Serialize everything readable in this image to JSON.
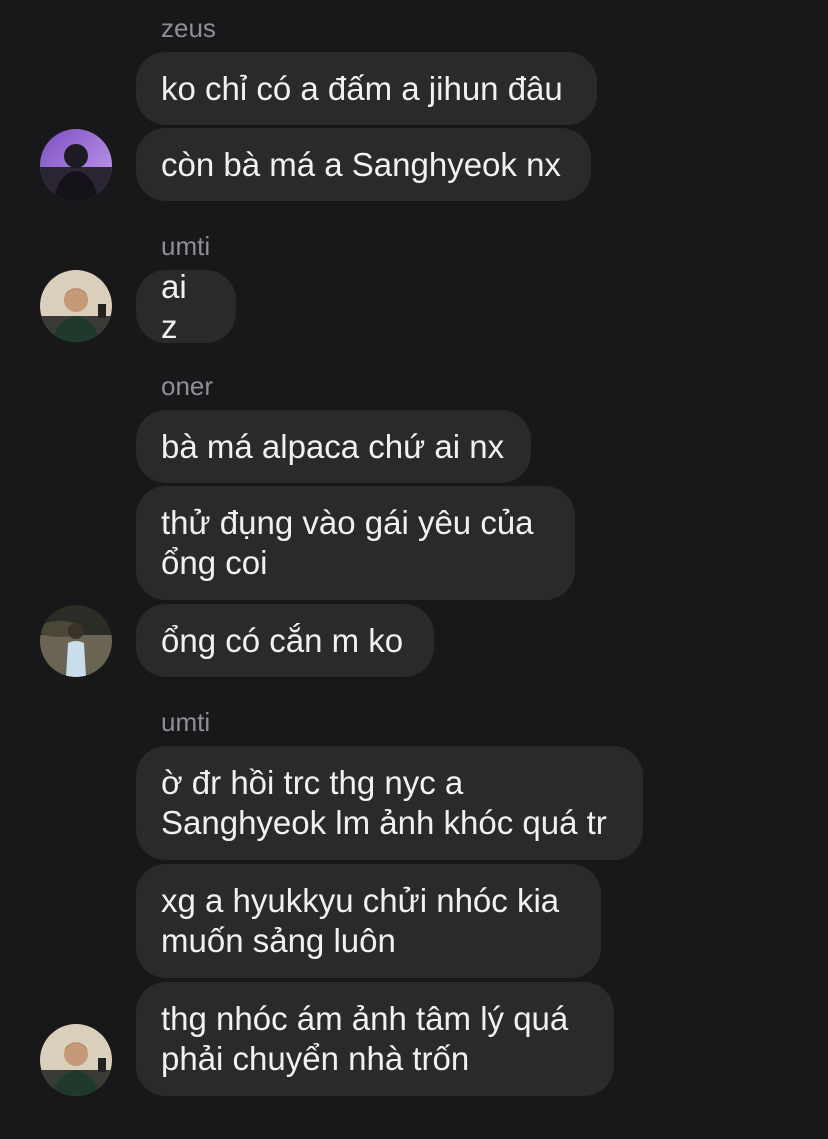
{
  "chat": {
    "groups": [
      {
        "sender": "zeus",
        "messages": [
          "ko chỉ có a đấm a jihun đâu",
          "còn bà má a Sanghyeok nx"
        ]
      },
      {
        "sender": "umti",
        "messages": [
          "ai z"
        ]
      },
      {
        "sender": "oner",
        "messages": [
          "bà má alpaca chứ ai nx",
          "thử đụng vào gái yêu của\nổng coi",
          "ổng có cắn m ko"
        ]
      },
      {
        "sender": "umti",
        "messages": [
          "ờ đr hồi trc thg nyc a\nSanghyeok lm ảnh khóc quá tr",
          "xg a hyukkyu chửi nhóc kia\nmuốn sảng luôn",
          "thg nhóc ám ảnh tâm lý quá\nphải chuyển nhà trốn"
        ]
      }
    ]
  },
  "colors": {
    "background": "#18181a",
    "bubble": "#2a2a2d",
    "sender_text": "#8e8e93",
    "message_text": "#f1f1f1"
  }
}
